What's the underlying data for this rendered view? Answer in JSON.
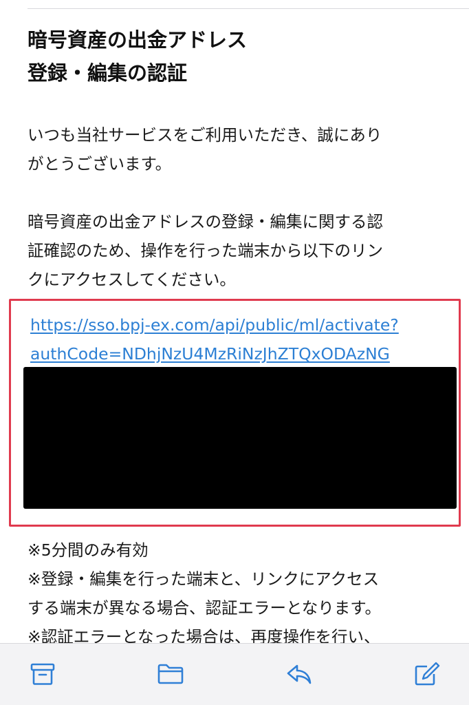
{
  "email": {
    "subject_lines": [
      "暗号資産の出金アドレス",
      "登録・編集の認証"
    ],
    "greeting_lines": [
      "いつも当社サービスをご利用いただき、誠にあり",
      "がとうございます。"
    ],
    "instruction_lines": [
      "暗号資産の出金アドレスの登録・編集に関する認",
      "証確認のため、操作を行った端末から以下のリン",
      "クにアクセスしてください。"
    ],
    "link_lines": [
      "https://sso.bpj-ex.com/api/public/ml/activate?",
      "authCode=NDhjNzU4MzRiNzJhZTQxODAzNG"
    ],
    "notes_lines": [
      "※5分間のみ有効",
      "※登録・編集を行った端末と、リンクにアクセス",
      "する端末が異なる場合、認証エラーとなります。",
      "※認証エラーとなった場合は、再度操作を行い、"
    ]
  },
  "toolbar": {
    "icons": [
      "archive-icon",
      "folder-icon",
      "reply-icon",
      "compose-icon"
    ],
    "icon_color": "#2f7fd6"
  },
  "colors": {
    "highlight_border": "#e03a4e",
    "link": "#2c7fd4",
    "redaction": "#000000"
  }
}
